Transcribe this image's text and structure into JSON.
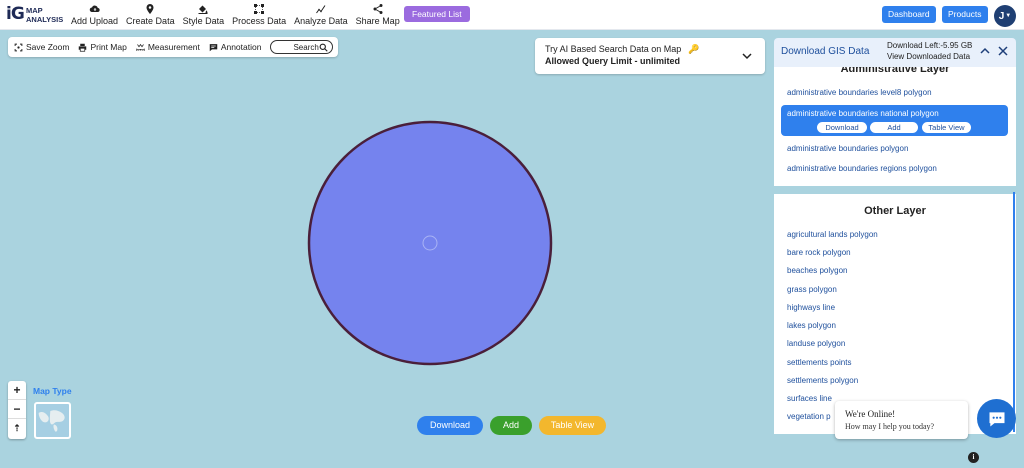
{
  "logo": {
    "mark": "iG",
    "line1": "MAP",
    "line2": "ANALYSIS"
  },
  "nav": [
    {
      "label": "Add Upload",
      "icon": "cloud-upload-icon"
    },
    {
      "label": "Create Data",
      "icon": "map-pin-icon"
    },
    {
      "label": "Style Data",
      "icon": "paint-bucket-icon"
    },
    {
      "label": "Process Data",
      "icon": "nodes-icon"
    },
    {
      "label": "Analyze Data",
      "icon": "analyze-icon"
    },
    {
      "label": "Share Map",
      "icon": "share-icon"
    }
  ],
  "featured_label": "Featured List",
  "header_buttons": {
    "dashboard": "Dashboard",
    "products": "Products"
  },
  "user_initial": "J",
  "tools": {
    "save_zoom": "Save Zoom",
    "print_map": "Print Map",
    "measurement": "Measurement",
    "annotation": "Annotation",
    "search": "Search"
  },
  "ai_panel": {
    "line1": "Try AI Based Search Data on Map",
    "line2": "Allowed Query Limit - unlimited"
  },
  "map": {
    "polygon_fill": "#7583ee",
    "polygon_stroke": "#4a1f3a",
    "map_type_label": "Map Type",
    "zoom_in": "+",
    "zoom_out": "−",
    "reset": "⇡"
  },
  "bottom_buttons": {
    "download": "Download",
    "add": "Add",
    "table_view": "Table View"
  },
  "gis_panel": {
    "title": "Download GIS Data",
    "download_left": "Download Left:-5.95 GB",
    "view_downloaded": "View Downloaded Data",
    "admin_heading": "Administrative Layer",
    "admin_layers": [
      "administrative boundaries level8 polygon",
      "administrative boundaries national polygon",
      "administrative boundaries polygon",
      "administrative boundaries regions polygon"
    ],
    "selected_actions": {
      "download": "Download",
      "add": "Add",
      "table_view": "Table View"
    },
    "other_heading": "Other Layer",
    "other_layers": [
      "agricultural lands polygon",
      "bare rock polygon",
      "beaches polygon",
      "grass polygon",
      "highways line",
      "lakes polygon",
      "landuse polygon",
      "settlements points",
      "settlements polygon",
      "surfaces line",
      "vegetation p"
    ]
  },
  "chat": {
    "line1": "We're Online!",
    "line2": "How may I help you today?"
  },
  "colors": {
    "accent": "#2f80ed",
    "featured": "#9b6bdf",
    "add": "#3aa02c",
    "table_view": "#f3b72d",
    "water": "#aad3df"
  }
}
